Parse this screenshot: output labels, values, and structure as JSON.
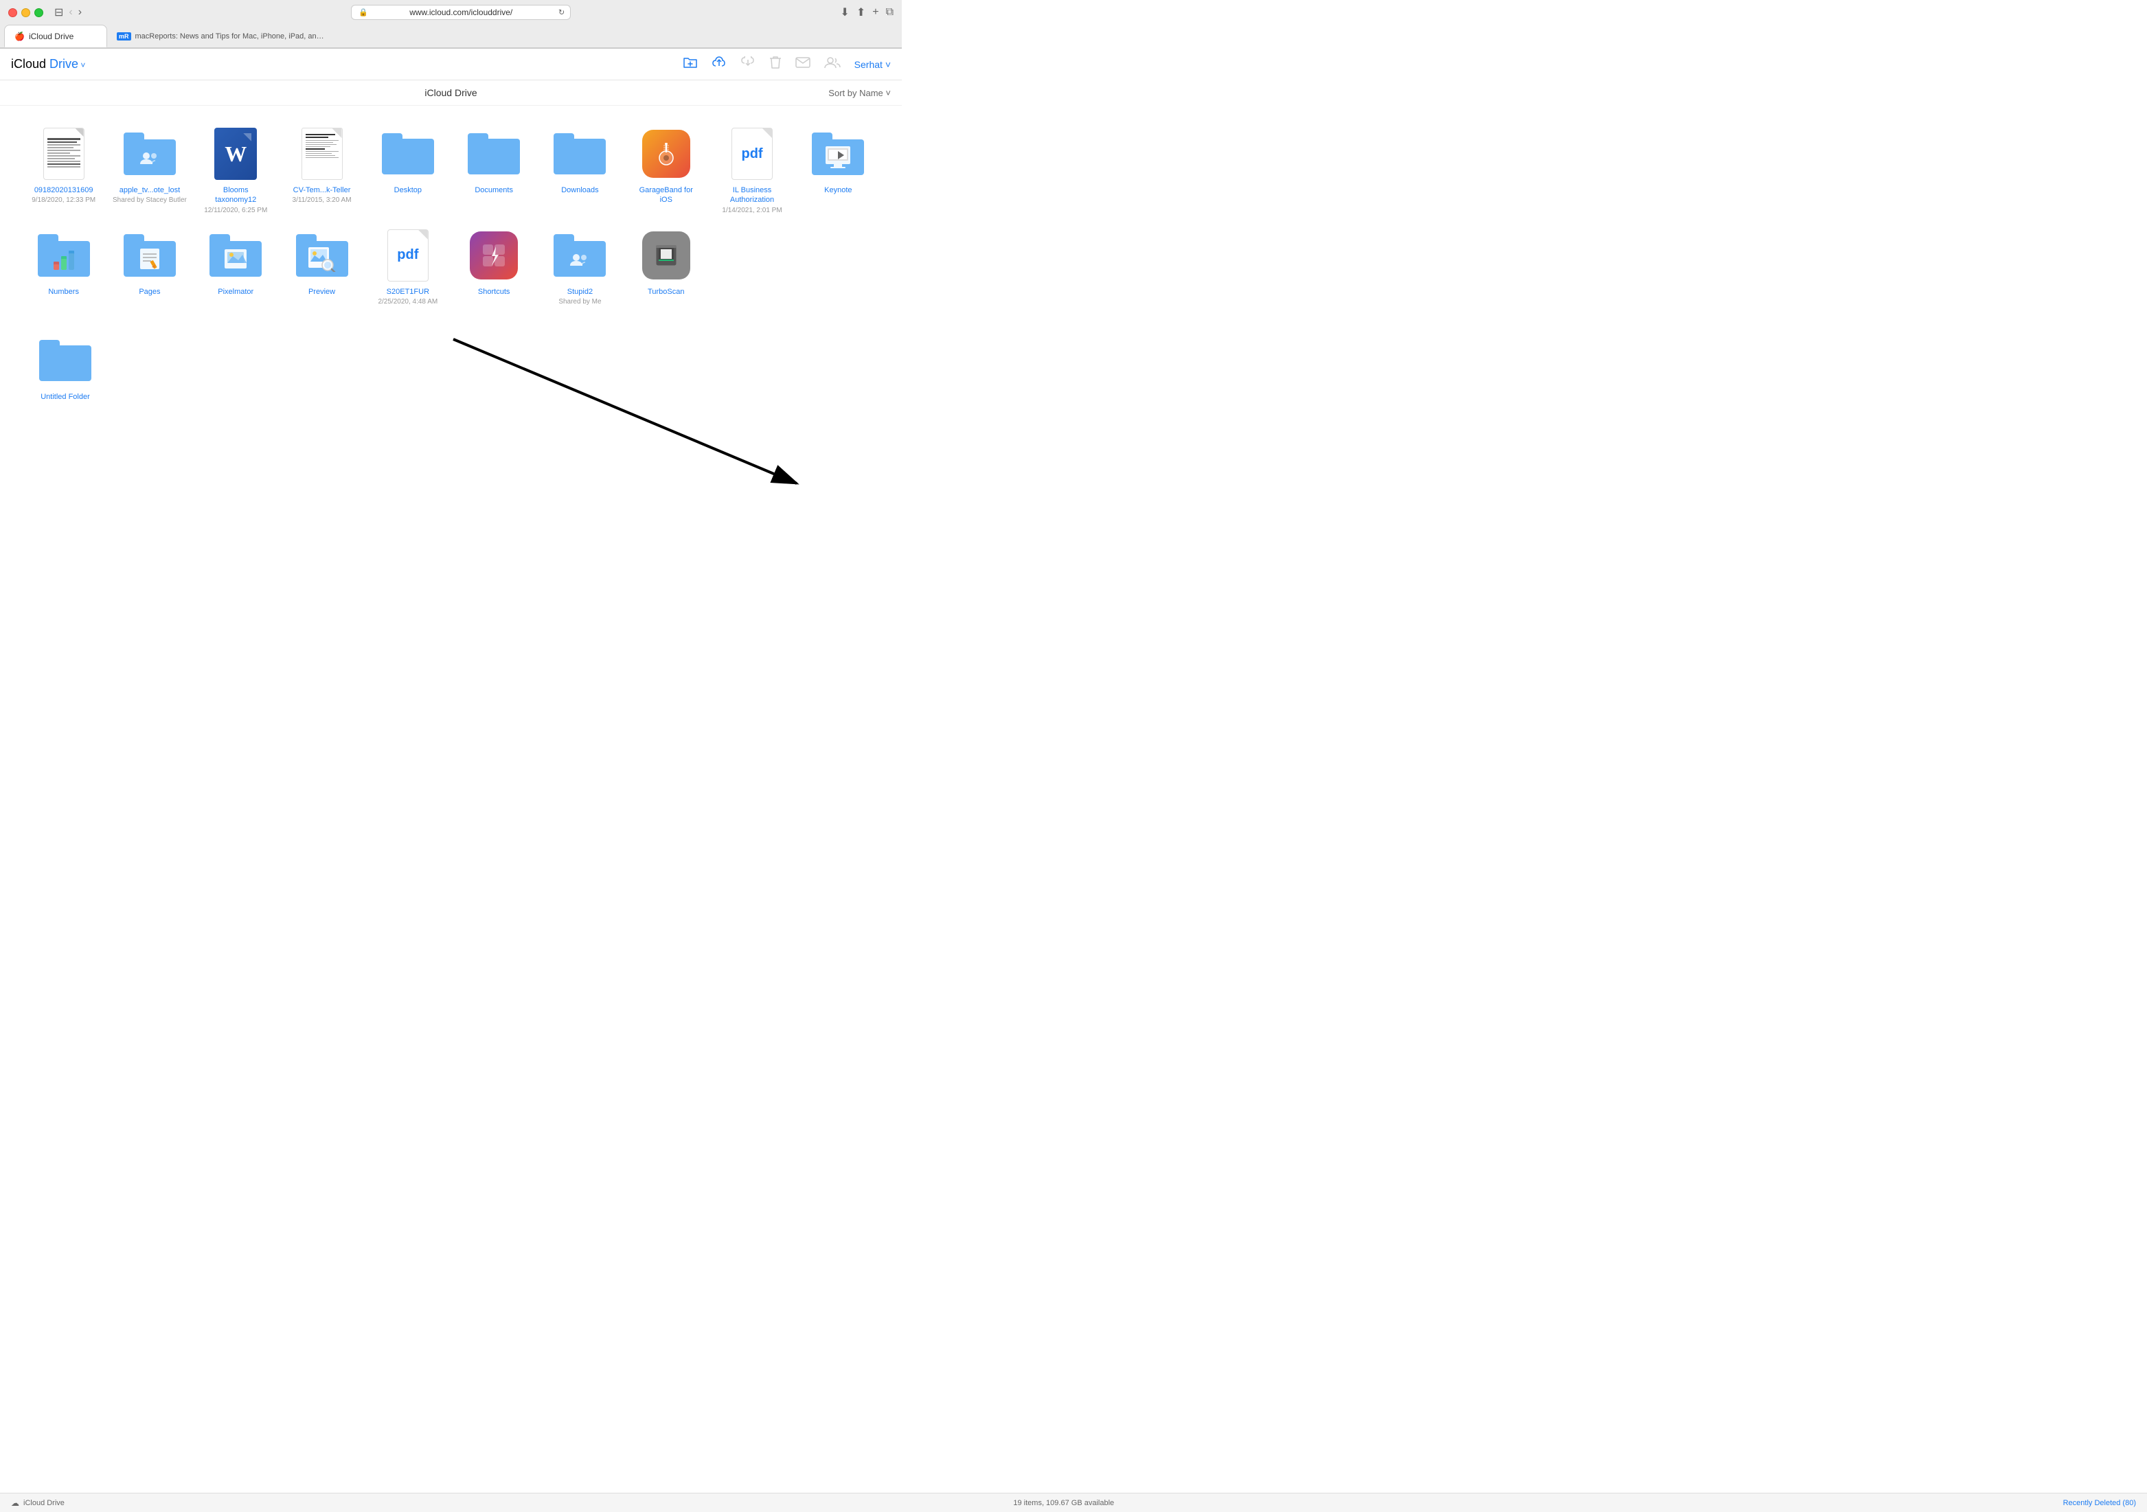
{
  "browser": {
    "address": "www.icloud.com/iclouddrive/",
    "tab1_label": "iCloud Drive",
    "tab2_label": "macReports: News and Tips for Mac, iPhone, iPad, and all things Apple"
  },
  "toolbar": {
    "app_title_icloud": "iCloud",
    "app_title_drive": " Drive",
    "dropdown_char": "˅",
    "user_label": "Serhat",
    "user_dropdown": "˅"
  },
  "content": {
    "title": "iCloud Drive",
    "sort_label": "Sort by Name",
    "sort_dropdown": "˅"
  },
  "files": [
    {
      "id": "f1",
      "name": "09182020131609",
      "meta": "9/18/2020, 12:33 PM",
      "type": "document"
    },
    {
      "id": "f2",
      "name": "apple_tv...ote_lost",
      "meta": "Shared by Stacey Butler",
      "type": "folder-shared"
    },
    {
      "id": "f3",
      "name": "Blooms taxonomy12",
      "meta": "12/11/2020, 6:25 PM",
      "type": "word"
    },
    {
      "id": "f4",
      "name": "CV-Tem...k-Teller",
      "meta": "3/11/2015, 3:20 AM",
      "type": "cv-doc"
    },
    {
      "id": "f5",
      "name": "Desktop",
      "meta": "",
      "type": "folder"
    },
    {
      "id": "f6",
      "name": "Documents",
      "meta": "",
      "type": "folder"
    },
    {
      "id": "f7",
      "name": "Downloads",
      "meta": "",
      "type": "folder"
    },
    {
      "id": "f8",
      "name": "GarageBand for iOS",
      "meta": "",
      "type": "garageband"
    },
    {
      "id": "f9",
      "name": "IL Business Authorization",
      "meta": "1/14/2021, 2:01 PM",
      "type": "pdf"
    },
    {
      "id": "f10",
      "name": "Keynote",
      "meta": "",
      "type": "folder-app",
      "app": "keynote"
    },
    {
      "id": "f11",
      "name": "Numbers",
      "meta": "",
      "type": "folder-app",
      "app": "numbers"
    },
    {
      "id": "f12",
      "name": "Pages",
      "meta": "",
      "type": "folder-app",
      "app": "pages"
    },
    {
      "id": "f13",
      "name": "Pixelmator",
      "meta": "",
      "type": "folder-app",
      "app": "pixelmator"
    },
    {
      "id": "f14",
      "name": "Preview",
      "meta": "",
      "type": "preview"
    },
    {
      "id": "f15",
      "name": "S20ET1FUR",
      "meta": "2/25/2020, 4:48 AM",
      "type": "pdf2"
    },
    {
      "id": "f16",
      "name": "Shortcuts",
      "meta": "",
      "type": "shortcuts"
    },
    {
      "id": "f17",
      "name": "Stupid2",
      "meta": "Shared by Me",
      "type": "folder-shared2"
    },
    {
      "id": "f18",
      "name": "TurboScan",
      "meta": "",
      "type": "turboscan"
    },
    {
      "id": "f19",
      "name": "Untitled Folder",
      "meta": "",
      "type": "folder"
    }
  ],
  "status": {
    "app_label": "iCloud Drive",
    "items_info": "19 items, 109.67 GB available",
    "recently_deleted": "Recently Deleted (80)"
  }
}
